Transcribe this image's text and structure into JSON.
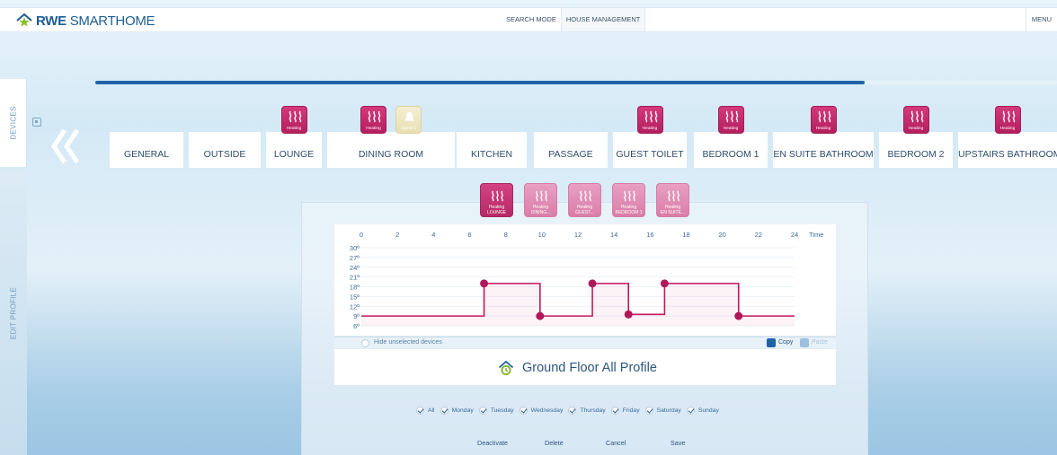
{
  "app": {
    "logo_bold": "RWE",
    "logo_rest": "SMARTHOME"
  },
  "topnav": {
    "items": [
      "SEARCH MODE",
      "HOUSE MANAGEMENT"
    ],
    "menu": "MENU"
  },
  "progress": {
    "fraction": 0.8
  },
  "side_tabs": {
    "devices": "DEVICES",
    "edit_profile": "EDIT PROFILE"
  },
  "rooms": [
    {
      "name": "GENERAL",
      "devices": []
    },
    {
      "name": "OUTSIDE",
      "devices": []
    },
    {
      "name": "LOUNGE",
      "devices": [
        "Heating"
      ]
    },
    {
      "name": "DINING ROOM",
      "devices": [
        "Heating",
        "Signal 1"
      ]
    },
    {
      "name": "KITCHEN",
      "devices": []
    },
    {
      "name": "PASSAGE",
      "devices": []
    },
    {
      "name": "GUEST TOILET",
      "devices": [
        "Heating"
      ]
    },
    {
      "name": "BEDROOM 1",
      "devices": [
        "Heating"
      ]
    },
    {
      "name": "EN SUITE BATHROOM",
      "devices": [
        "Heating"
      ]
    },
    {
      "name": "BEDROOM 2",
      "devices": [
        "Heating"
      ]
    },
    {
      "name": "UPSTAIRS BATHROOM",
      "devices": [
        "Heating"
      ]
    }
  ],
  "selected_devices": [
    {
      "line1": "Heating",
      "line2": "LOUNGE",
      "active": true
    },
    {
      "line1": "Heating",
      "line2": "DINING...",
      "active": false
    },
    {
      "line1": "Heating",
      "line2": "GUEST...",
      "active": false
    },
    {
      "line1": "Heating",
      "line2": "BEDROOM 1",
      "active": false
    },
    {
      "line1": "Heating",
      "line2": "EN SUITE...",
      "active": false
    }
  ],
  "chart_data": {
    "type": "line",
    "step": true,
    "x_ticks": [
      0,
      2,
      4,
      6,
      8,
      10,
      12,
      14,
      16,
      18,
      20,
      22,
      24
    ],
    "x_unit_label": "Time",
    "y_ticks": [
      30,
      27,
      24,
      21,
      18,
      15,
      12,
      9,
      6
    ],
    "y_tick_suffix": "º",
    "xlim": [
      0,
      24
    ],
    "ylim": [
      6,
      30
    ],
    "series": [
      {
        "color": "#c2185b",
        "x": [
          0,
          6.8,
          6.8,
          9.9,
          9.9,
          12.8,
          12.8,
          14.8,
          14.8,
          16.8,
          16.8,
          20.9,
          20.9,
          24
        ],
        "y": [
          9,
          9,
          19,
          19,
          9,
          9,
          19,
          19,
          9.5,
          9.5,
          19,
          19,
          9,
          9
        ],
        "markers_x": [
          6.8,
          9.9,
          12.8,
          14.8,
          16.8,
          20.9
        ],
        "markers_y": [
          19,
          9,
          19,
          9.5,
          19,
          9
        ]
      }
    ]
  },
  "hide_unselected": "Hide unselected devices",
  "copy_label": "Copy",
  "paste_label": "Paste",
  "profile_title": "Ground Floor All Profile",
  "days": [
    "All",
    "Monday",
    "Tuesday",
    "Wednesday",
    "Thursday",
    "Friday",
    "Saturday",
    "Sunday"
  ],
  "actions": [
    "Deactivate",
    "Delete",
    "Cancel",
    "Save"
  ]
}
